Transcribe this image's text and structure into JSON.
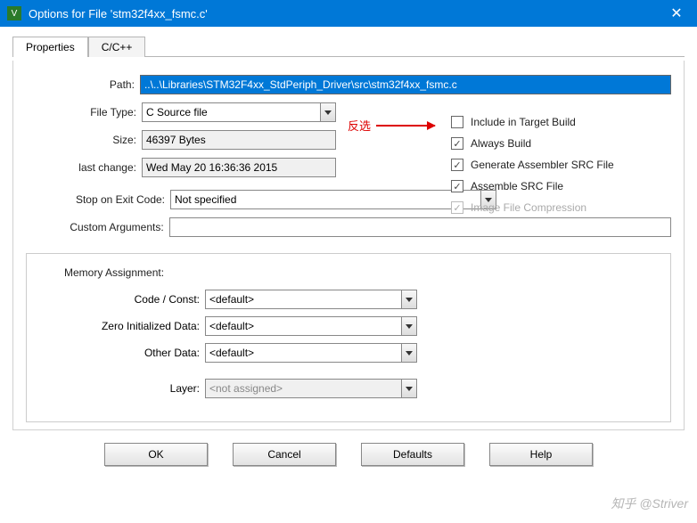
{
  "window": {
    "title": "Options for File 'stm32f4xx_fsmc.c'"
  },
  "tabs": {
    "properties": "Properties",
    "ccpp": "C/C++"
  },
  "labels": {
    "path": "Path:",
    "filetype": "File Type:",
    "size": "Size:",
    "lastchange": "last change:",
    "stopcode": "Stop on Exit Code:",
    "customargs": "Custom Arguments:",
    "memory_title": "Memory Assignment:",
    "code_const": "Code / Const:",
    "zero_init": "Zero Initialized Data:",
    "other_data": "Other Data:",
    "layer": "Layer:"
  },
  "fields": {
    "path": "..\\..\\Libraries\\STM32F4xx_StdPeriph_Driver\\src\\stm32f4xx_fsmc.c",
    "filetype": "C Source file",
    "size": "46397 Bytes",
    "lastchange": "Wed May 20 16:36:36 2015",
    "stopcode": "Not specified",
    "customargs": "",
    "code_const": "<default>",
    "zero_init": "<default>",
    "other_data": "<default>",
    "layer": "<not assigned>"
  },
  "checks": {
    "include_target": "Include in Target Build",
    "always_build": "Always Build",
    "gen_asm": "Generate Assembler SRC File",
    "assemble_src": "Assemble SRC File",
    "image_compress": "Image File Compression"
  },
  "annotation": {
    "text": "反选"
  },
  "buttons": {
    "ok": "OK",
    "cancel": "Cancel",
    "defaults": "Defaults",
    "help": "Help"
  },
  "watermark": "知乎 @Striver"
}
